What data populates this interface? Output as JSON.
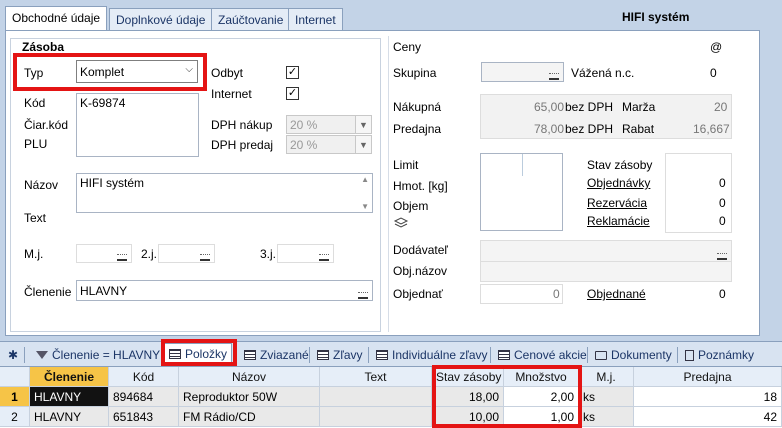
{
  "tabs": [
    "Obchodné údaje",
    "Doplnkové údaje",
    "Zaúčtovanie",
    "Internet"
  ],
  "title": "HIFI systém",
  "left": {
    "section_title": "Zásoba",
    "typ_label": "Typ",
    "typ_value": "Komplet",
    "kod_label": "Kód",
    "kod_value": "K-69874",
    "ciar_label": "Čiar.kód",
    "plu_label": "PLU",
    "odbyt_label": "Odbyt",
    "internet_label": "Internet",
    "odbyt_checked": true,
    "internet_checked": true,
    "dph_nakup_label": "DPH nákup",
    "dph_nakup_value": "20 %",
    "dph_predaj_label": "DPH predaj",
    "dph_predaj_value": "20 %",
    "nazov_label": "Názov",
    "nazov_value": "HIFI systém",
    "text_label": "Text",
    "mj_label": "M.j.",
    "mj2_label": "2.j.",
    "mj3_label": "3.j.",
    "clenenie_label": "Členenie",
    "clenenie_value": "HLAVNY"
  },
  "right": {
    "ceny_label": "Ceny",
    "at_label": "@",
    "skupina_label": "Skupina",
    "vazena_label": "Vážená n.c.",
    "vazena_value": "0",
    "nakupna_label": "Nákupná",
    "nakupna_value": "65,00",
    "bez_dph_1": "bez DPH",
    "marza_label": "Marža",
    "marza_value": "20",
    "predajna_label": "Predajna",
    "predajna_value": "78,00",
    "bez_dph_2": "bez DPH",
    "rabat_label": "Rabat",
    "rabat_value": "16,667",
    "limit_label": "Limit",
    "hmot_label": "Hmot. [kg]",
    "objem_label": "Objem",
    "stav_label": "Stav zásoby",
    "objednavky_label": "Objednávky",
    "objednavky_value": "0",
    "rezervacia_label": "Rezervácia",
    "rezervacia_value": "0",
    "reklamacie_label": "Reklamácie",
    "reklamacie_value": "0",
    "dodavatel_label": "Dodávateľ",
    "objnazov_label": "Obj.názov",
    "objednat_label": "Objednať",
    "objednat_value": "0",
    "objednane_label": "Objednané",
    "objednane_value": "0"
  },
  "bottom_tabs": {
    "star": "✱",
    "filter": "Členenie = HLAVNY",
    "items": [
      "Položky",
      "Zviazané",
      "Zľavy",
      "Individuálne zľavy",
      "Cenové akcie",
      "Dokumenty",
      "Poznámky"
    ]
  },
  "grid": {
    "columns": [
      "Členenie",
      "Kód",
      "Názov",
      "Text",
      "Stav zásoby",
      "Množstvo",
      "M.j.",
      "Predajna"
    ],
    "rows": [
      {
        "num": "1",
        "clenenie": "HLAVNY",
        "kod": "894684",
        "nazov": "Reproduktor 50W",
        "text": "",
        "stav": "18,00",
        "mnozstvo": "2,00",
        "mj": "ks",
        "predajna": "18"
      },
      {
        "num": "2",
        "clenenie": "HLAVNY",
        "kod": "651843",
        "nazov": "FM Rádio/CD",
        "text": "",
        "stav": "10,00",
        "mnozstvo": "1,00",
        "mj": "ks",
        "predajna": "42"
      }
    ]
  }
}
